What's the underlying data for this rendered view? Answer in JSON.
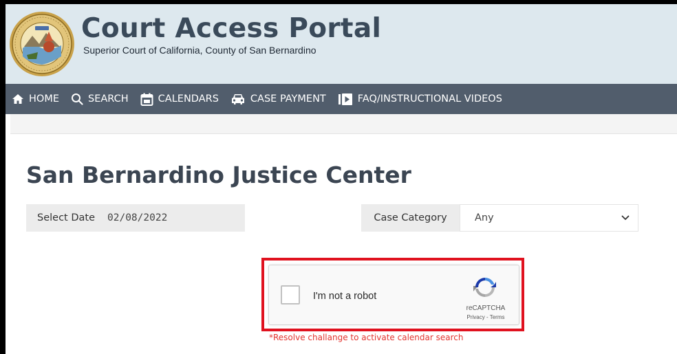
{
  "header": {
    "title": "Court Access Portal",
    "subtitle": "Superior Court of California, County of San Bernardino",
    "seal_icon": "county-seal-logo"
  },
  "nav": {
    "items": [
      {
        "label": "HOME",
        "icon": "home-icon"
      },
      {
        "label": "SEARCH",
        "icon": "search-icon"
      },
      {
        "label": "CALENDARS",
        "icon": "calendar-icon"
      },
      {
        "label": "CASE PAYMENT",
        "icon": "car-icon"
      },
      {
        "label": "FAQ/INSTRUCTIONAL VIDEOS",
        "icon": "video-play-icon"
      }
    ]
  },
  "page": {
    "title": "San Bernardino Justice Center"
  },
  "filters": {
    "date_label": "Select Date",
    "date_value": "02/08/2022",
    "category_label": "Case Category",
    "category_value": "Any"
  },
  "captcha": {
    "label": "I'm not a robot",
    "brand": "reCAPTCHA",
    "privacy": "Privacy",
    "separator": " - ",
    "terms": "Terms",
    "checked": false
  },
  "note": "*Resolve challange to activate calendar search",
  "colors": {
    "header_bg": "#dde8ee",
    "nav_bg": "#515d6c",
    "title_text": "#3a4a5a",
    "highlight_border": "#e0121f",
    "note_text": "#e3342f"
  }
}
